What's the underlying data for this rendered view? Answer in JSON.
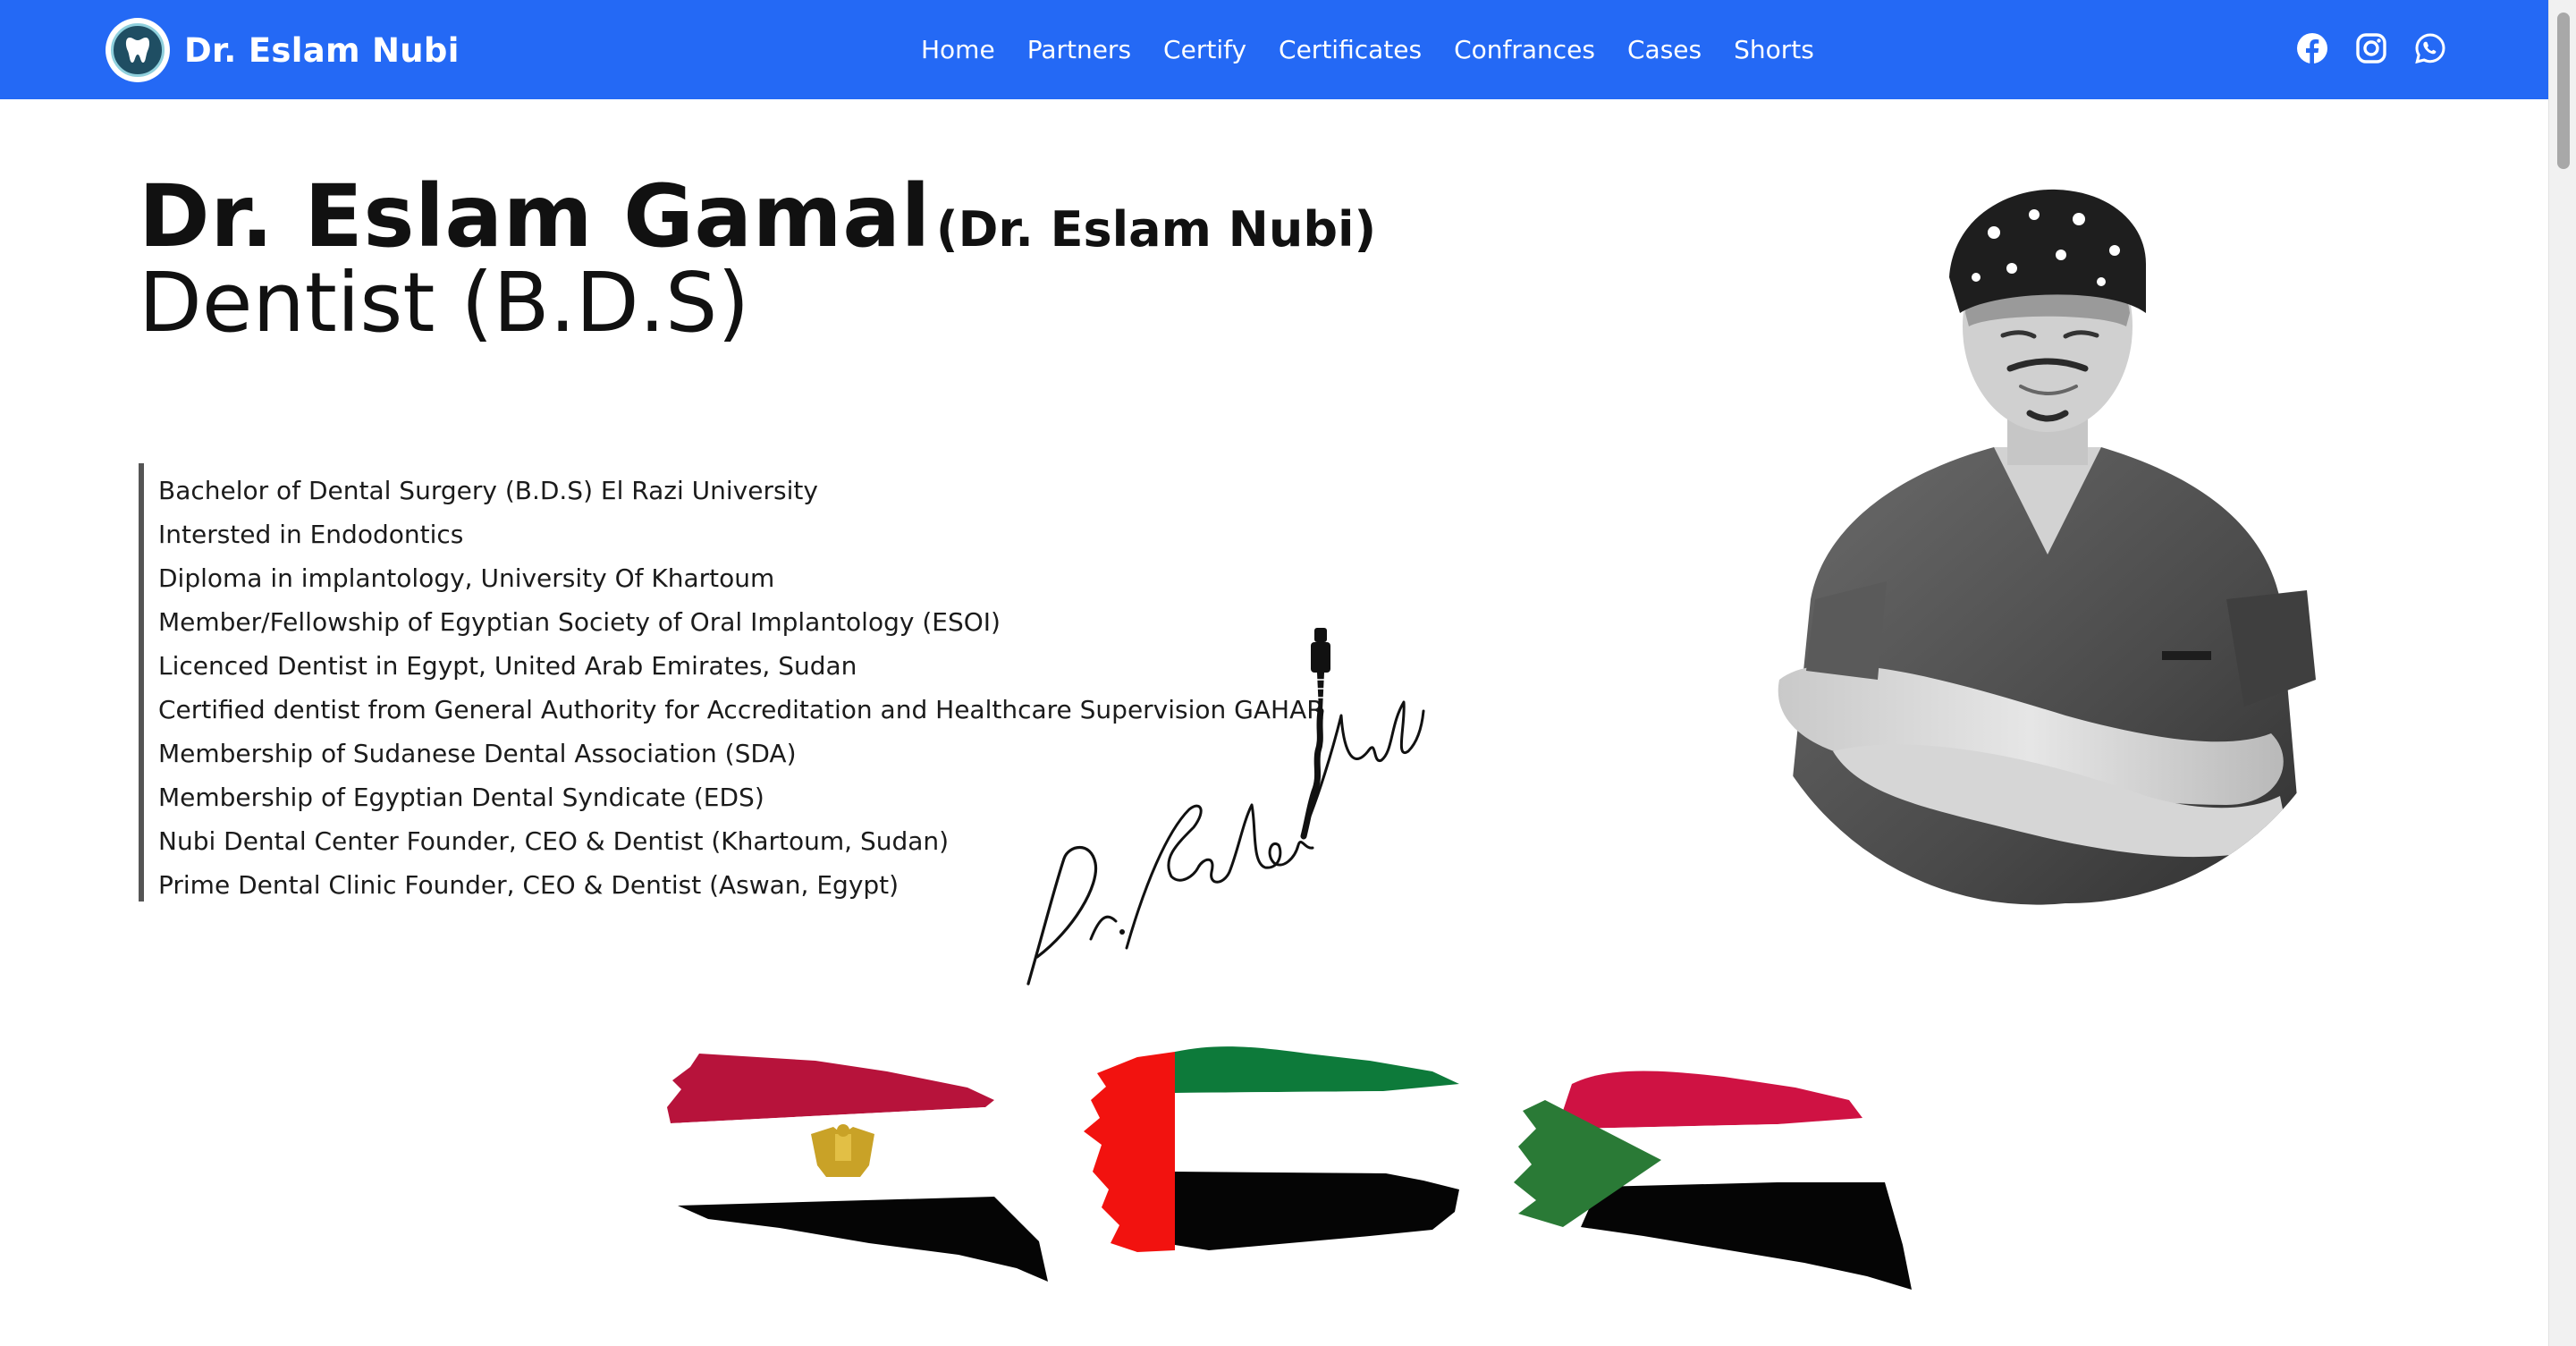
{
  "navbar": {
    "brand": "Dr. Eslam Nubi",
    "links": [
      "Home",
      "Partners",
      "Certify",
      "Certificates",
      "Confrances",
      "Cases",
      "Shorts"
    ],
    "social": [
      "facebook-icon",
      "instagram-icon",
      "whatsapp-icon"
    ],
    "color": "#2469f5"
  },
  "hero": {
    "name": "Dr. Eslam Gamal",
    "alt_name": "(Dr. Eslam Nubi)",
    "subtitle": "Dentist (B.D.S)"
  },
  "bio": [
    "Bachelor of Dental Surgery (B.D.S) El Razi University",
    "Intersted in Endodontics",
    "Diploma in implantology, University Of Khartoum",
    "Member/Fellowship of Egyptian Society of Oral Implantology (ESOI)",
    "Licenced Dentist in Egypt, United Arab Emirates, Sudan",
    "Certified dentist from General Authority for Accreditation and Healthcare Supervision GAHAR",
    "Membership of Sudanese Dental Association (SDA)",
    "Membership of Egyptian Dental Syndicate (EDS)",
    "Nubi Dental Center Founder, CEO & Dentist (Khartoum, Sudan)",
    "Prime Dental Clinic Founder, CEO & Dentist (Aswan, Egypt)"
  ],
  "flags": [
    "egypt-flag",
    "uae-flag",
    "sudan-flag"
  ]
}
